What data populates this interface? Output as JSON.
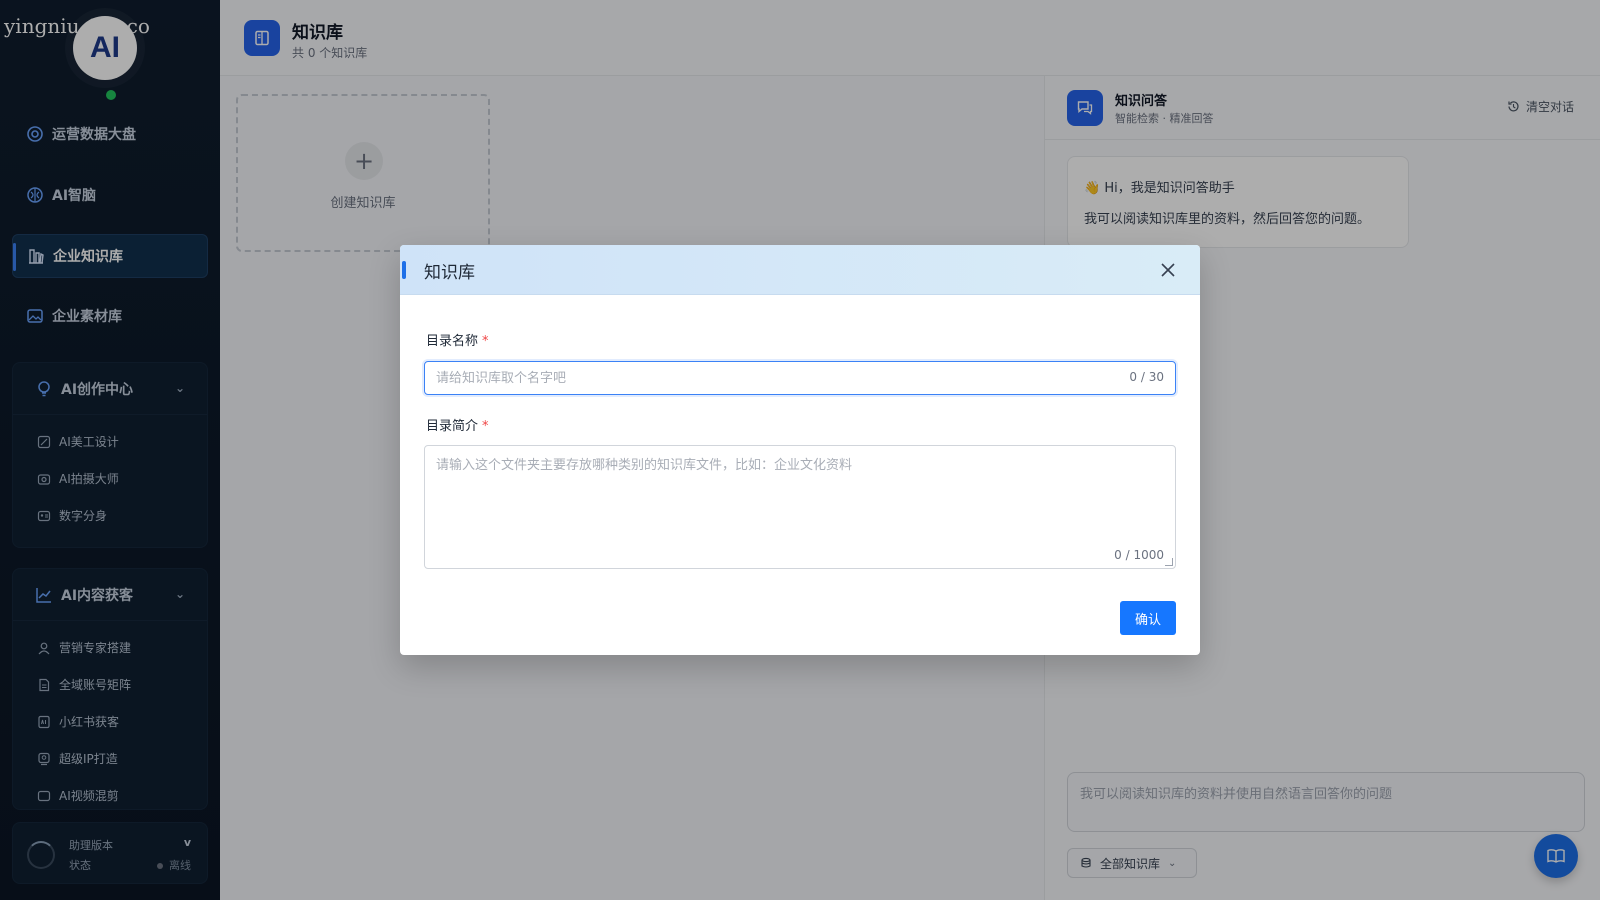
{
  "watermark": "yingniu.10v.co",
  "sidebar": {
    "logo_text": "AI",
    "nav_items": [
      {
        "label": "运营数据大盘",
        "icon": "dashboard-icon"
      },
      {
        "label": "AI智脑",
        "icon": "brain-icon"
      },
      {
        "label": "企业知识库",
        "icon": "library-icon",
        "active": true
      },
      {
        "label": "企业素材库",
        "icon": "image-icon"
      }
    ],
    "groups": [
      {
        "label": "AI创作中心",
        "icon": "lightbulb-icon",
        "items": [
          {
            "label": "AI美工设计",
            "icon": "design-icon"
          },
          {
            "label": "AI拍摄大师",
            "icon": "camera-icon"
          },
          {
            "label": "数字分身",
            "icon": "avatar-icon"
          }
        ]
      },
      {
        "label": "AI内容获客",
        "icon": "chart-icon",
        "items": [
          {
            "label": "营销专家搭建",
            "icon": "user-icon"
          },
          {
            "label": "全域账号矩阵",
            "icon": "document-icon"
          },
          {
            "label": "小红书获客",
            "icon": "ai-doc-icon"
          },
          {
            "label": "超级IP打造",
            "icon": "ip-icon"
          },
          {
            "label": "AI视频混剪",
            "icon": "video-icon"
          }
        ]
      }
    ],
    "footer": {
      "version_label": "助理版本",
      "version_value": "v",
      "status_label": "状态",
      "status_value": "离线"
    }
  },
  "header": {
    "title": "知识库",
    "subtitle": "共 0 个知识库"
  },
  "create_card": {
    "label": "创建知识库"
  },
  "chat": {
    "title": "知识问答",
    "subtitle": "智能检索 · 精准回答",
    "clear_label": "清空对话",
    "greeting": "👋 Hi，我是知识问答助手",
    "intro": "我可以阅读知识库里的资料，然后回答您的问题。",
    "input_placeholder": "我可以阅读知识库的资料并使用自然语言回答你的问题",
    "kb_select_label": "全部知识库"
  },
  "modal": {
    "title": "知识库",
    "name_label": "目录名称",
    "name_placeholder": "请给知识库取个名字吧",
    "name_value": "",
    "name_count": "0 / 30",
    "desc_label": "目录简介",
    "desc_placeholder": "请输入这个文件夹主要存放哪种类别的知识库文件，比如：企业文化资料",
    "desc_value": "",
    "desc_count": "0 / 1000",
    "required_mark": "*",
    "confirm_label": "确认"
  },
  "colors": {
    "accent": "#1677ff",
    "sidebar_bg": "#0f1d2e",
    "modal_header": "#cfe3f8",
    "online": "#22c55e"
  }
}
